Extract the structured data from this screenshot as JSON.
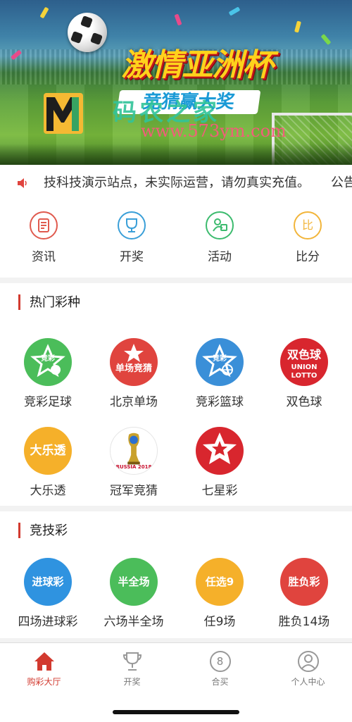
{
  "banner": {
    "title": "激情亚洲杯",
    "subtitle": "竞猜赢大奖",
    "watermark_text": "码农之家",
    "watermark_url": "www.573ym.com"
  },
  "notice": {
    "icon": "speaker-icon",
    "text": "技科技演示站点，未实际运营，请勿真实充值。",
    "text2": "公告"
  },
  "quick_nav": [
    {
      "label": "资讯",
      "icon": "news-icon",
      "color": "#e05a4e"
    },
    {
      "label": "开奖",
      "icon": "trophy-icon",
      "color": "#3a9fd8"
    },
    {
      "label": "活动",
      "icon": "activity-icon",
      "color": "#3cbb6e"
    },
    {
      "label": "比分",
      "icon": "score-icon",
      "color": "#f2b53a",
      "glyph": "比"
    }
  ],
  "hot": {
    "title": "热门彩种",
    "items": [
      {
        "label": "竞彩足球",
        "icon": "football-lottery-icon",
        "color": "#4bbd5a",
        "badge": "竞彩"
      },
      {
        "label": "北京单场",
        "icon": "beijing-single-icon",
        "color": "#e0443e",
        "badge": "单场竞猜"
      },
      {
        "label": "竞彩篮球",
        "icon": "basketball-lottery-icon",
        "color": "#3a8fd8",
        "badge": "竞彩"
      },
      {
        "label": "双色球",
        "icon": "double-color-ball-icon",
        "color": "#d8262e",
        "badge": "双色球"
      },
      {
        "label": "大乐透",
        "icon": "super-lotto-icon",
        "color": "#f5b02a",
        "badge": "大乐透"
      },
      {
        "label": "冠军竞猜",
        "icon": "champion-guess-icon",
        "color": "#ffffff",
        "badge": "RUSSIA 2018"
      },
      {
        "label": "七星彩",
        "icon": "seven-star-icon",
        "color": "#d8262e",
        "badge": ""
      }
    ]
  },
  "jingji": {
    "title": "竞技彩",
    "items": [
      {
        "label": "四场进球彩",
        "icon": "four-goals-icon",
        "color": "#2f93e0",
        "badge": "进球彩"
      },
      {
        "label": "六场半全场",
        "icon": "six-half-full-icon",
        "color": "#4bbd5a",
        "badge": "半全场"
      },
      {
        "label": "任9场",
        "icon": "any-nine-icon",
        "color": "#f5b02a",
        "badge": "任选9"
      },
      {
        "label": "胜负14场",
        "icon": "win-lose-14-icon",
        "color": "#e0443e",
        "badge": "胜负彩"
      }
    ]
  },
  "tabbar": {
    "active_color": "#d23a2f",
    "items": [
      {
        "label": "购彩大厅",
        "icon": "home-icon"
      },
      {
        "label": "开奖",
        "icon": "trophy-icon"
      },
      {
        "label": "合买",
        "icon": "group-buy-icon",
        "glyph": "8"
      },
      {
        "label": "个人中心",
        "icon": "user-icon"
      }
    ]
  }
}
